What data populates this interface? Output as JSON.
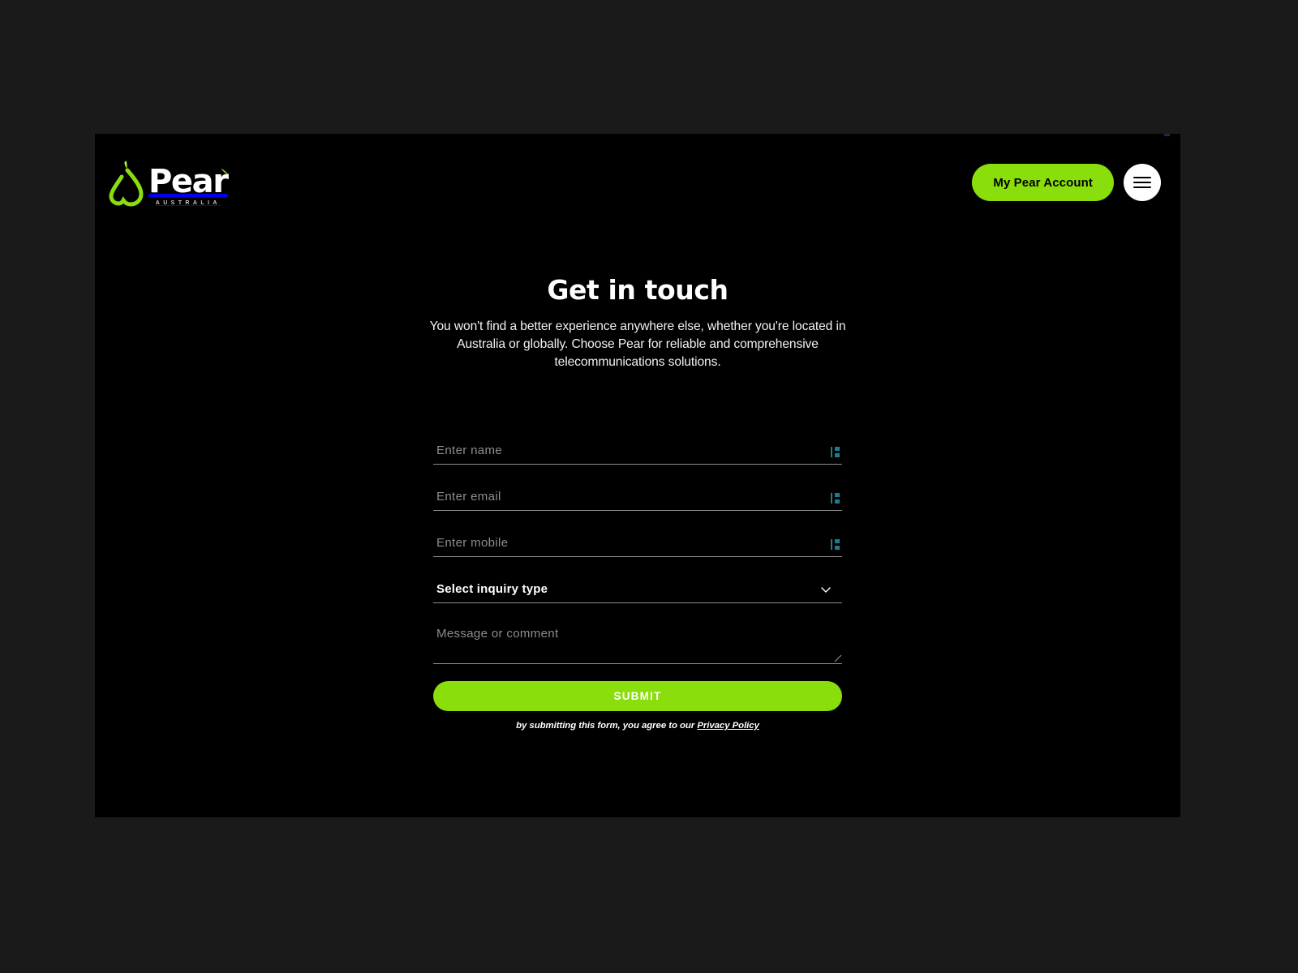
{
  "colors": {
    "page_background": "#000000",
    "outer_background": "#1a1a1a",
    "brand_green": "#8ade0c",
    "text_primary": "#ffffff",
    "placeholder": "#8a8f92",
    "field_underline": "#8e8e8e",
    "autofill_icon": "#1c7d8f"
  },
  "header": {
    "brand": {
      "word": "Pear",
      "sub": "AUSTRALIA",
      "mark_icon": "pear-logo-icon"
    },
    "account_button_label": "My Pear Account",
    "menu_button_icon": "hamburger-menu-icon"
  },
  "main": {
    "title": "Get in touch",
    "description": "You won't find a better experience anywhere else, whether you're located in Australia or globally. Choose Pear for reliable and comprehensive telecommunications solutions."
  },
  "form": {
    "fields": [
      {
        "name": "name",
        "placeholder": "Enter name",
        "value": "",
        "icon": "autofill-icon"
      },
      {
        "name": "email",
        "placeholder": "Enter email",
        "value": "",
        "icon": "autofill-icon"
      },
      {
        "name": "mobile",
        "placeholder": "Enter mobile",
        "value": "",
        "icon": "autofill-icon"
      }
    ],
    "select": {
      "label": "Select inquiry type",
      "value": "Select inquiry type",
      "icon": "chevron-down-icon"
    },
    "message": {
      "placeholder": "Message or comment",
      "value": ""
    },
    "submit_label": "SUBMIT",
    "legal_text": "by submitting this form, you agree to our ",
    "legal_link": "Privacy Policy"
  }
}
